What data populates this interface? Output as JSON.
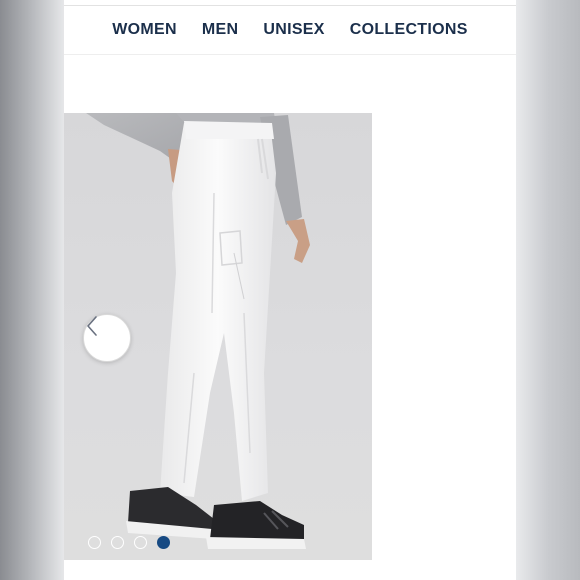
{
  "nav": {
    "items": [
      {
        "label": "WOMEN"
      },
      {
        "label": "MEN"
      },
      {
        "label": "UNISEX"
      },
      {
        "label": "COLLECTIONS"
      }
    ]
  },
  "gallery": {
    "image": "white-jogger-scrub-pants-photo",
    "prev_icon": "chevron-left-icon",
    "slide_count": 4,
    "active_slide": 4
  },
  "colors": {
    "nav_text": "#1b2f4b",
    "active_dot": "#174a83"
  }
}
